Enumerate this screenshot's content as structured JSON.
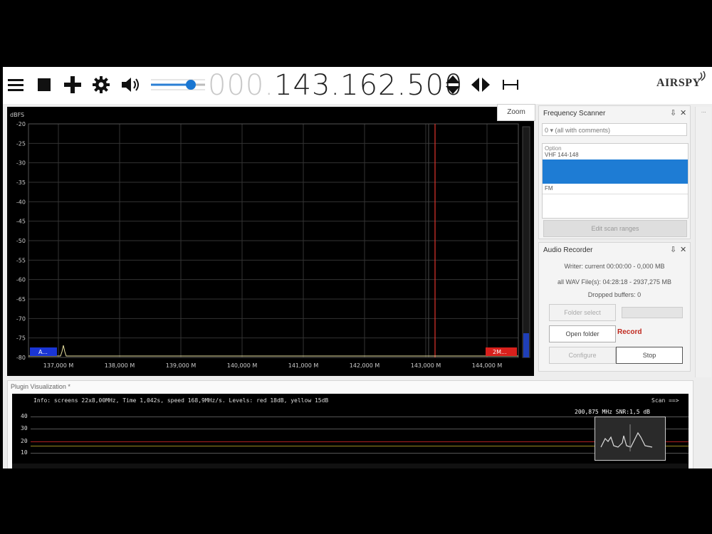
{
  "toolbar": {
    "freq_prefix": "000.",
    "freq_main": "143.162.500",
    "logo": "AIRSPY"
  },
  "spectrum": {
    "unit_label": "dBFS",
    "y_ticks": [
      "-20",
      "-25",
      "-30",
      "-35",
      "-40",
      "-45",
      "-50",
      "-55",
      "-60",
      "-65",
      "-70",
      "-75",
      "-80"
    ],
    "x_ticks": [
      "137,000 M",
      "138,000 M",
      "139,000 M",
      "140,000 M",
      "141,000 M",
      "142,000 M",
      "143,000 M",
      "144,000 M"
    ],
    "left_badge": "A...",
    "right_badge": "2M...",
    "marker_color": "#e0342c",
    "badge_left_color": "#1a35d6",
    "badge_right_color": "#d8201c"
  },
  "zoom_tab": "Zoom",
  "scanner": {
    "title": "Frequency Scanner",
    "dropdown": "0 ▾ (all with comments)",
    "list_items": [
      "Option",
      "VHF 144-148",
      "",
      "",
      "FM"
    ],
    "edit_button": "Edit scan ranges"
  },
  "recorder": {
    "title": "Audio Recorder",
    "written": "Writer: current 00:00:00 - 0,000 MB",
    "all_files": "all WAV File(s): 04:28:18 - 2937,275 MB",
    "dropped": "Dropped buffers: 0",
    "folder_select": "Folder select",
    "open_folder": "Open folder",
    "status": "Record",
    "configure": "Configure",
    "stop": "Stop"
  },
  "viz": {
    "title": "Plugin Visualization *",
    "info": "Info: screens 22x8,00MHz, Time 1,042s, speed 168,9MHz/s. Levels: red 18dB, yellow 15dB",
    "scan_label": "Scan ==>",
    "readout": "200,875 MHz  SNR:1,5 dB",
    "y_ticks": [
      "40",
      "30",
      "20",
      "10"
    ]
  }
}
